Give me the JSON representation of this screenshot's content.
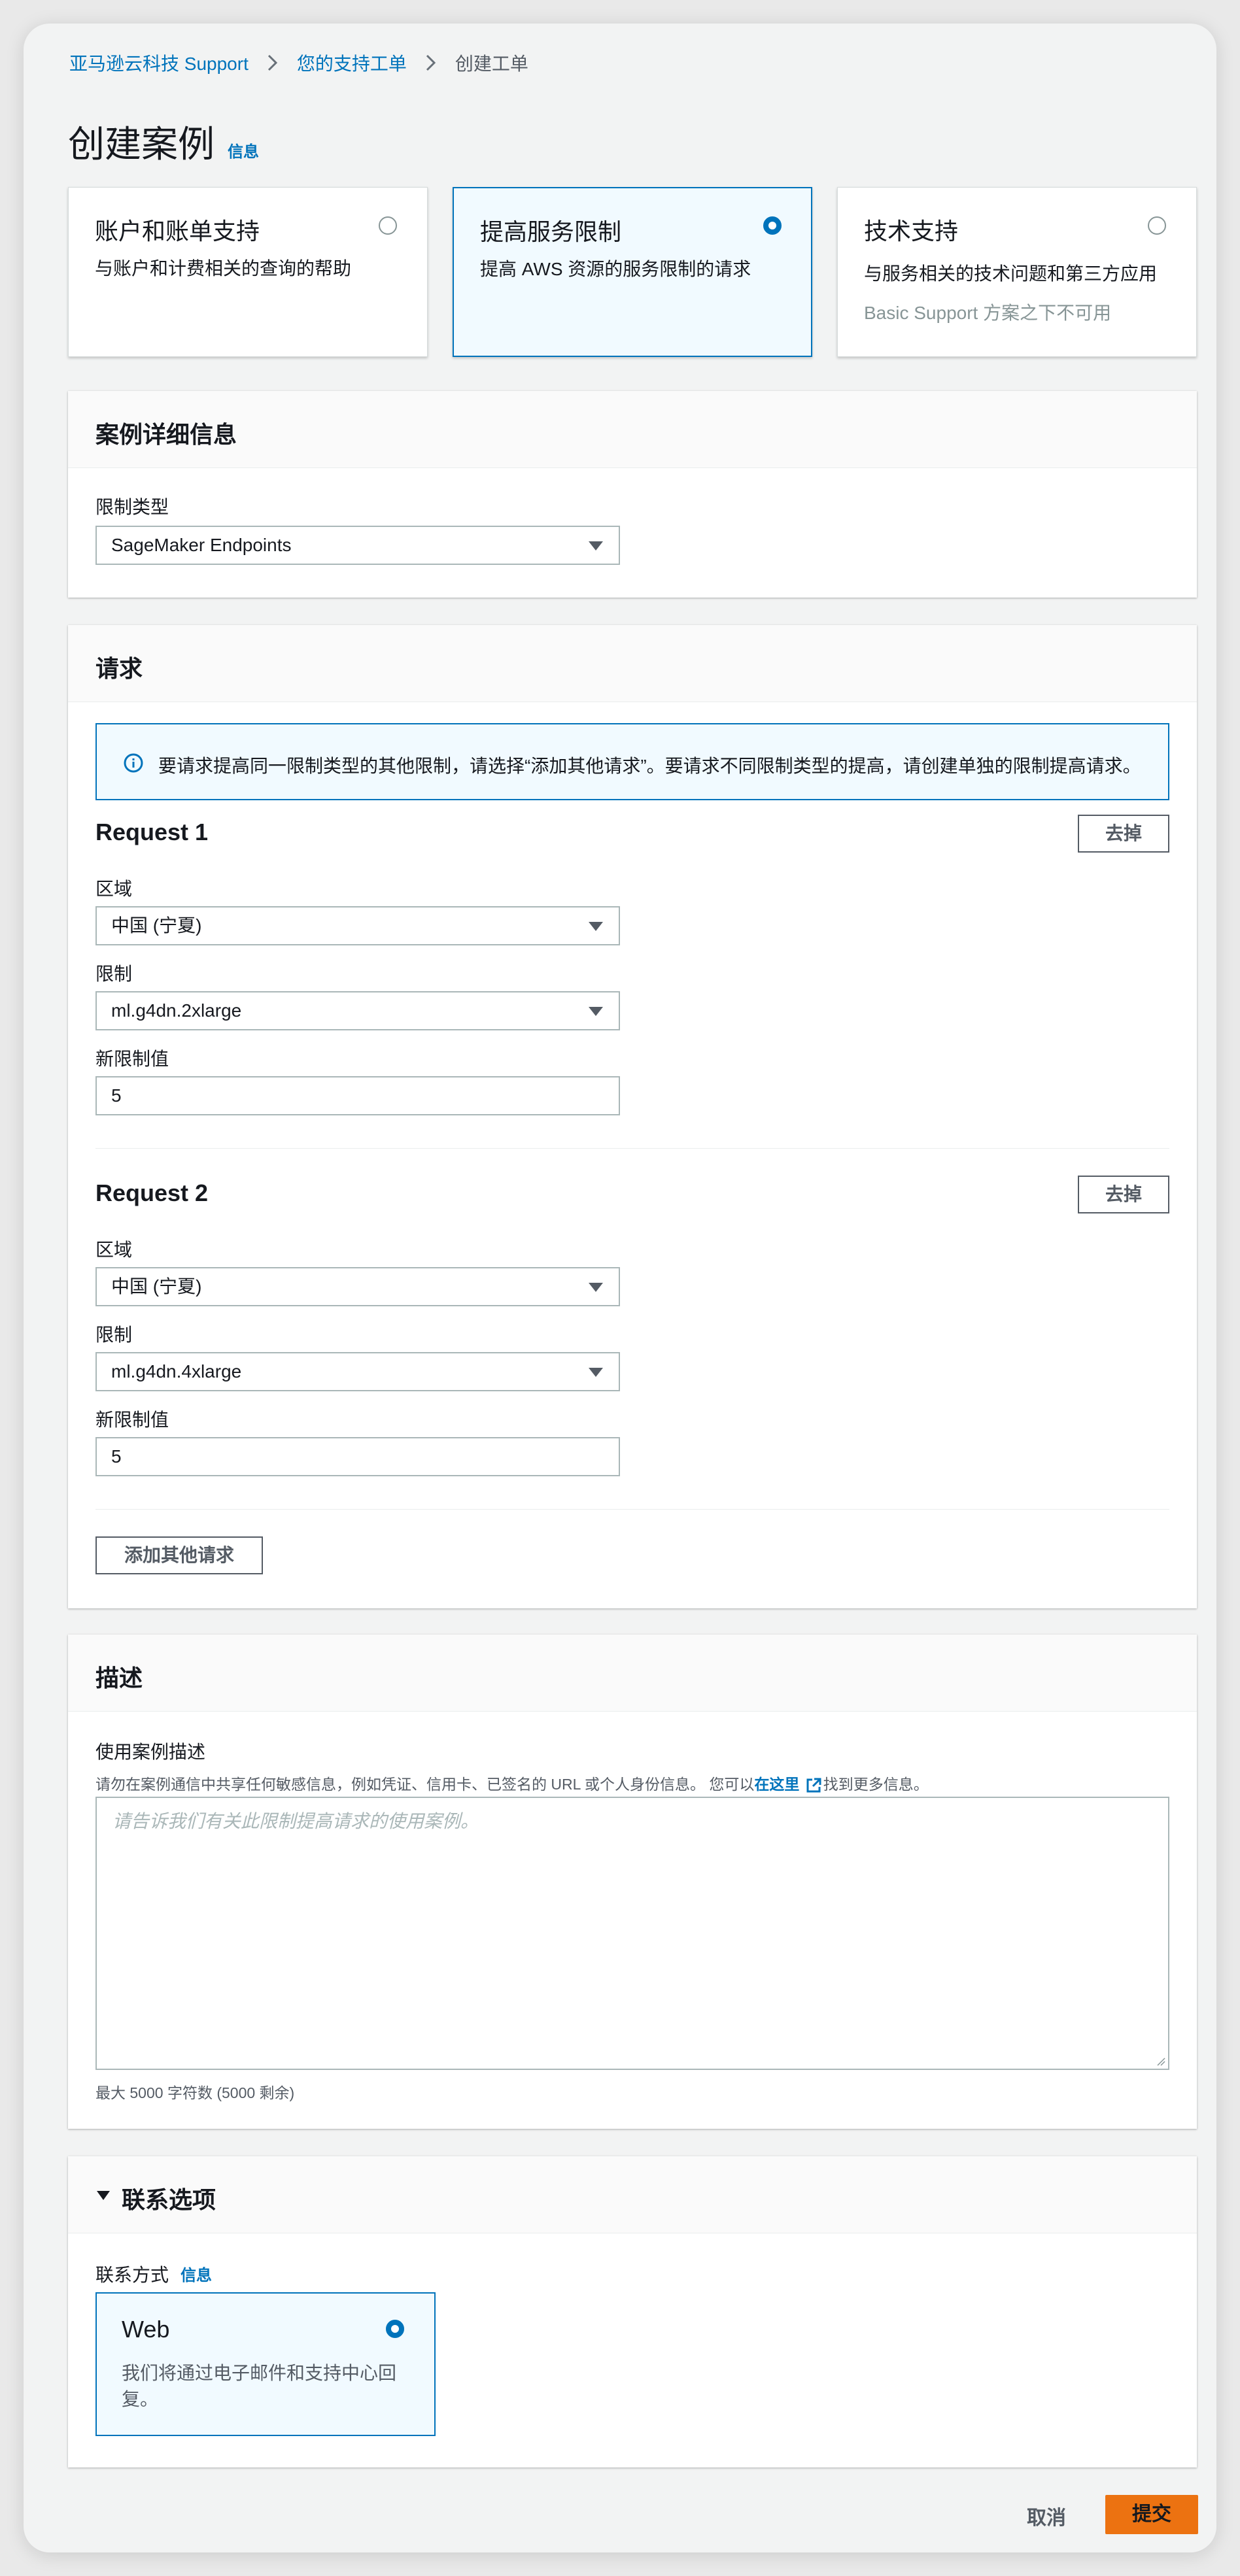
{
  "breadcrumb": {
    "items": [
      "亚马逊云科技 Support",
      "您的支持工单",
      "创建工单"
    ]
  },
  "page": {
    "title": "创建案例",
    "info_label": "信息"
  },
  "case_types": [
    {
      "title": "账户和账单支持",
      "desc": "与账户和计费相关的查询的帮助",
      "note": "",
      "selected": false
    },
    {
      "title": "提高服务限制",
      "desc": "提高 AWS 资源的服务限制的请求",
      "note": "",
      "selected": true
    },
    {
      "title": "技术支持",
      "desc": "与服务相关的技术问题和第三方应用",
      "note": "Basic Support 方案之下不可用",
      "selected": false
    }
  ],
  "case_details": {
    "header": "案例详细信息",
    "limit_type_label": "限制类型",
    "limit_type_value": "SageMaker Endpoints"
  },
  "requests": {
    "header": "请求",
    "alert": "要请求提高同一限制类型的其他限制，请选择“添加其他请求”。要请求不同限制类型的提高，请创建单独的限制提高请求。",
    "remove_label": "去掉",
    "region_label": "区域",
    "limit_label": "限制",
    "new_value_label": "新限制值",
    "items": [
      {
        "title": "Request 1",
        "region": "中国 (宁夏)",
        "limit": "ml.g4dn.2xlarge",
        "new_value": "5"
      },
      {
        "title": "Request 2",
        "region": "中国 (宁夏)",
        "limit": "ml.g4dn.4xlarge",
        "new_value": "5"
      }
    ],
    "add_button": "添加其他请求"
  },
  "description": {
    "header": "描述",
    "label": "使用案例描述",
    "hint_before": "请勿在案例通信中共享任何敏感信息，例如凭证、信用卡、已签名的 URL 或个人身份信息。 您可以",
    "hint_link": "在这里",
    "hint_after": "找到更多信息。",
    "placeholder": "请告诉我们有关此限制提高请求的使用案例。",
    "char_count": "最大 5000 字符数 (5000 剩余)"
  },
  "contact": {
    "header": "联系选项",
    "method_label": "联系方式",
    "info_label": "信息",
    "option_title": "Web",
    "option_desc_line1": "我们将通过电子邮件和支持中心回",
    "option_desc_line2": "复。"
  },
  "footer": {
    "cancel": "取消",
    "submit": "提交"
  },
  "colors": {
    "link": "#0073bb",
    "primary_button": "#ec7211",
    "selected_tile_bg": "#f1faff"
  }
}
